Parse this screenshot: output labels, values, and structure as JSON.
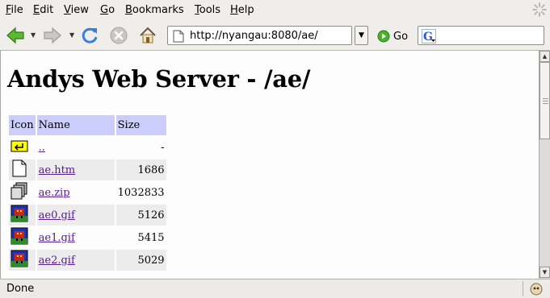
{
  "menu": {
    "items": [
      "File",
      "Edit",
      "View",
      "Go",
      "Bookmarks",
      "Tools",
      "Help"
    ]
  },
  "toolbar": {
    "url": "http://nyangau:8080/ae/",
    "go_label": "Go",
    "search_value": ""
  },
  "page": {
    "title": "Andys Web Server - /ae/",
    "table": {
      "headers": [
        "Icon",
        "Name",
        "Size"
      ],
      "rows": [
        {
          "icon": "parent-folder-icon",
          "name": "..",
          "size": "-"
        },
        {
          "icon": "document-icon",
          "name": "ae.htm",
          "size": "1686"
        },
        {
          "icon": "archive-icon",
          "name": "ae.zip",
          "size": "1032833"
        },
        {
          "icon": "image-icon",
          "name": "ae0.gif",
          "size": "5126"
        },
        {
          "icon": "image-icon",
          "name": "ae1.gif",
          "size": "5415"
        },
        {
          "icon": "image-icon",
          "name": "ae2.gif",
          "size": "5029"
        }
      ]
    }
  },
  "status": {
    "text": "Done"
  },
  "colors": {
    "table_header_bg": "#cbcdfc",
    "row_alt_bg": "#ececec",
    "link": "#551a8b"
  }
}
